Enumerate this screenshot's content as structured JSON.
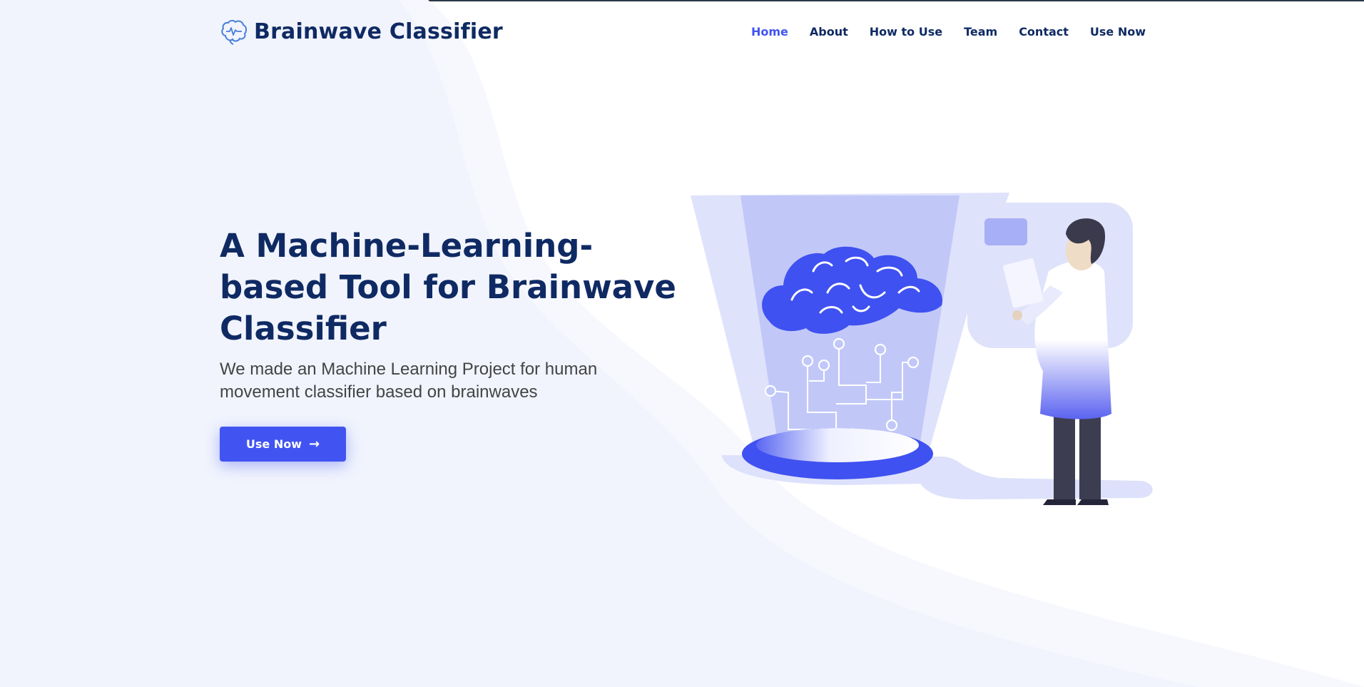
{
  "brand": {
    "name": "Brainwave Classifier",
    "icon": "brain-icon"
  },
  "nav": {
    "items": [
      {
        "label": "Home",
        "active": true
      },
      {
        "label": "About",
        "active": false
      },
      {
        "label": "How to Use",
        "active": false
      },
      {
        "label": "Team",
        "active": false
      },
      {
        "label": "Contact",
        "active": false
      },
      {
        "label": "Use Now",
        "active": false
      }
    ]
  },
  "hero": {
    "title": "A Machine-Learning-based Tool for Brainwave Classifier",
    "subtitle": "We made an Machine Learning Project for human movement classifier based on brainwaves",
    "cta_label": "Use Now",
    "cta_icon": "arrow-right-icon"
  },
  "colors": {
    "accent": "#4154f1",
    "heading": "#0f2a63",
    "text": "#444444",
    "background_wave": "#f2f5fd"
  }
}
